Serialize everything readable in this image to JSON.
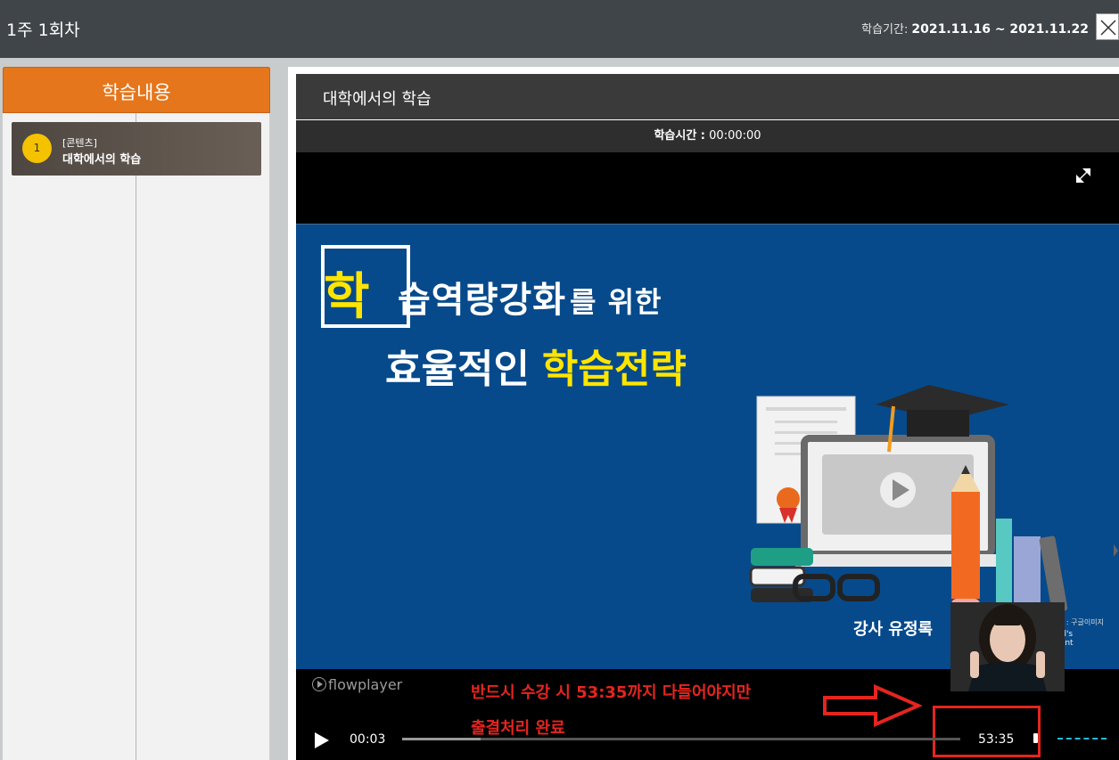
{
  "header": {
    "title": "1주 1회차",
    "period_label": "학습기간:",
    "period_value": "2021.11.16 ~ 2021.11.22"
  },
  "sidebar": {
    "heading": "학습내용",
    "items": [
      {
        "number": "1",
        "tag": "[콘텐츠]",
        "name": "대학에서의 학습"
      }
    ]
  },
  "content": {
    "title": "대학에서의 학습",
    "study_time_label": "학습시간 :",
    "study_time_value": "00:00:00"
  },
  "slide": {
    "big_char": "학",
    "line1_rest": "습역량강화",
    "line1_small": "를 위한",
    "line2_white": "효율적인",
    "line2_yellow": "학습전략",
    "lecturer": "강사 유정록",
    "credit1": "이미지 출처 : 구글이미지",
    "credit2": "© abyeol's PowerPoint"
  },
  "player": {
    "brand": "flowplayer",
    "current_time": "00:03",
    "duration": "53:35",
    "progress_fraction": 0.14
  },
  "annotation": {
    "line1": "반드시 수강 시 53:35까지 다들어야지만",
    "line2": "출결처리 완료"
  },
  "icons": {
    "close": "close-icon",
    "fullscreen": "fullscreen-icon",
    "play": "play-icon",
    "volume": "volume-icon"
  },
  "colors": {
    "topbar": "#404549",
    "sidebar_header": "#e5761b",
    "slide_bg": "#064a8b",
    "highlight_yellow": "#ffe500",
    "annotation_red": "#e5251f",
    "volume_accent": "#27b7d8"
  }
}
